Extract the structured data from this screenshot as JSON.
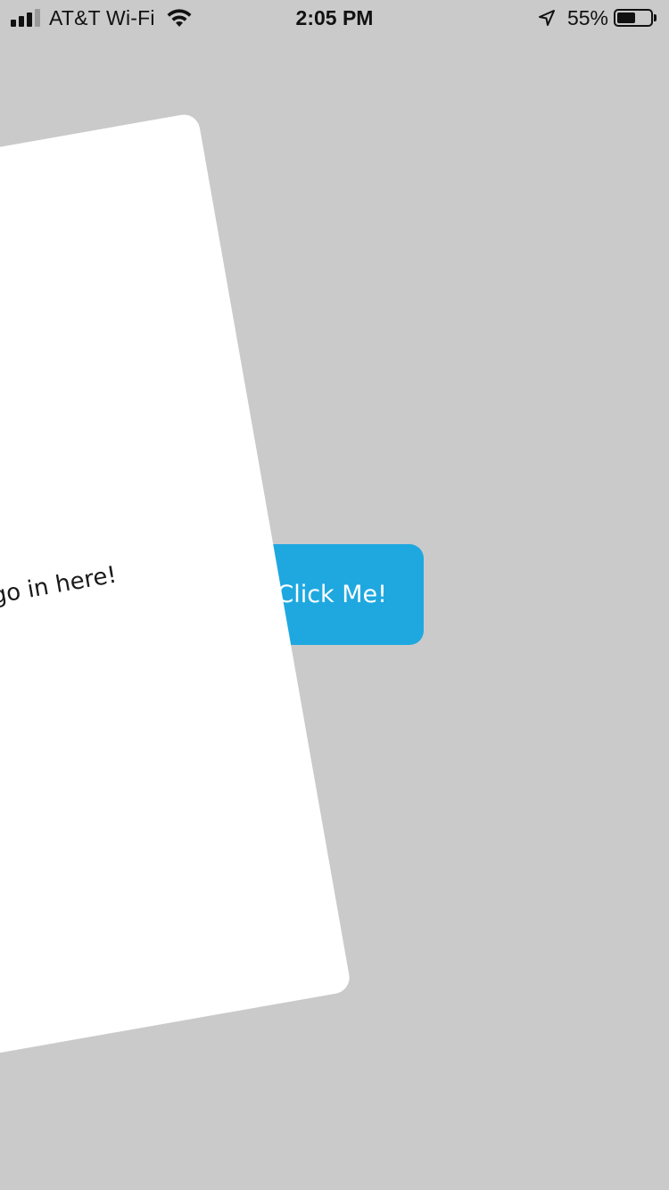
{
  "status_bar": {
    "carrier": "AT&T Wi-Fi",
    "time": "2:05 PM",
    "battery_percent": "55%",
    "battery_level": 0.55,
    "signal_bars": 4,
    "signal_bars_active": 3,
    "icons": [
      "signal-icon",
      "wifi-icon",
      "location-arrow-icon",
      "battery-icon"
    ]
  },
  "card": {
    "text": "n go in here!"
  },
  "button": {
    "label": "Click Me!",
    "color": "#1fa8e0"
  },
  "colors": {
    "background": "#cacaca",
    "card": "#ffffff",
    "text": "#1a1a1a"
  }
}
